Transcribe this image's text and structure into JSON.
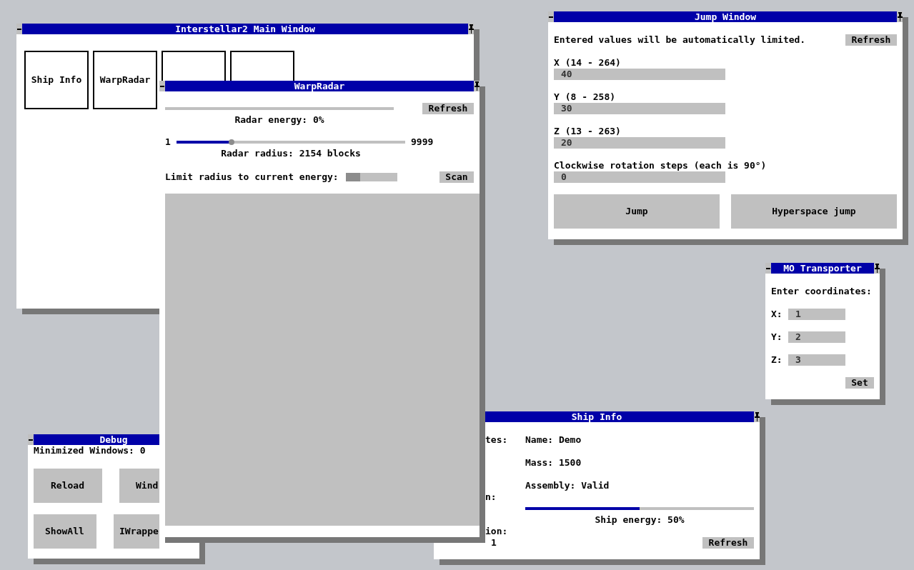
{
  "main_window": {
    "title": "Interstellar2 Main Window",
    "tiles": [
      {
        "kind": "labeled",
        "label": "Ship Info"
      },
      {
        "kind": "labeled",
        "label": "WarpRadar"
      },
      {
        "kind": "blank"
      },
      {
        "kind": "blank"
      }
    ]
  },
  "debug": {
    "title": "Debug",
    "minimized_text": "Minimized Windows: 0",
    "buttons": [
      "Reload",
      "Wind",
      "ShowAll",
      "IWrappe"
    ]
  },
  "ship_info": {
    "title": "Ship Info",
    "left_column": [
      "tes:",
      "n:",
      "ion:",
      "1"
    ],
    "fields": [
      "Name: Demo",
      "Mass: 1500",
      "Assembly: Valid"
    ],
    "energy_bar": {
      "level": 0.5
    },
    "energy_text": "Ship energy: 50%",
    "refresh_button": "Refresh"
  },
  "warp_radar": {
    "title": "WarpRadar",
    "energy_bar": {
      "level": 0
    },
    "refresh_button": "Refresh",
    "energy_text": "Radar energy: 0%",
    "radius_slider": {
      "min_label": "1",
      "max_label": "9999",
      "level": 0.24
    },
    "radius_text": "Radar radius: 2154 blocks",
    "limit_toggle": {
      "label": "Limit radius to current energy:",
      "on": false
    },
    "scan_button": "Scan"
  },
  "jump_window": {
    "title": "Jump Window",
    "note": "Entered values will be automatically limited.",
    "refresh_button": "Refresh",
    "fields": [
      {
        "label": "X (14 - 264)",
        "value": "40"
      },
      {
        "label": "Y (8 - 258)",
        "value": "30"
      },
      {
        "label": "Z (13 - 263)",
        "value": "20"
      },
      {
        "label": "Clockwise rotation steps (each is 90°)",
        "value": "0"
      }
    ],
    "buttons": [
      "Jump",
      "Hyperspace jump"
    ]
  },
  "mo_transporter": {
    "title": "MO Transporter",
    "prompt": "Enter coordinates:",
    "fields": [
      {
        "label": "X:",
        "value": "1"
      },
      {
        "label": "Y:",
        "value": "2"
      },
      {
        "label": "Z:",
        "value": "3"
      }
    ],
    "set_button": "Set"
  }
}
